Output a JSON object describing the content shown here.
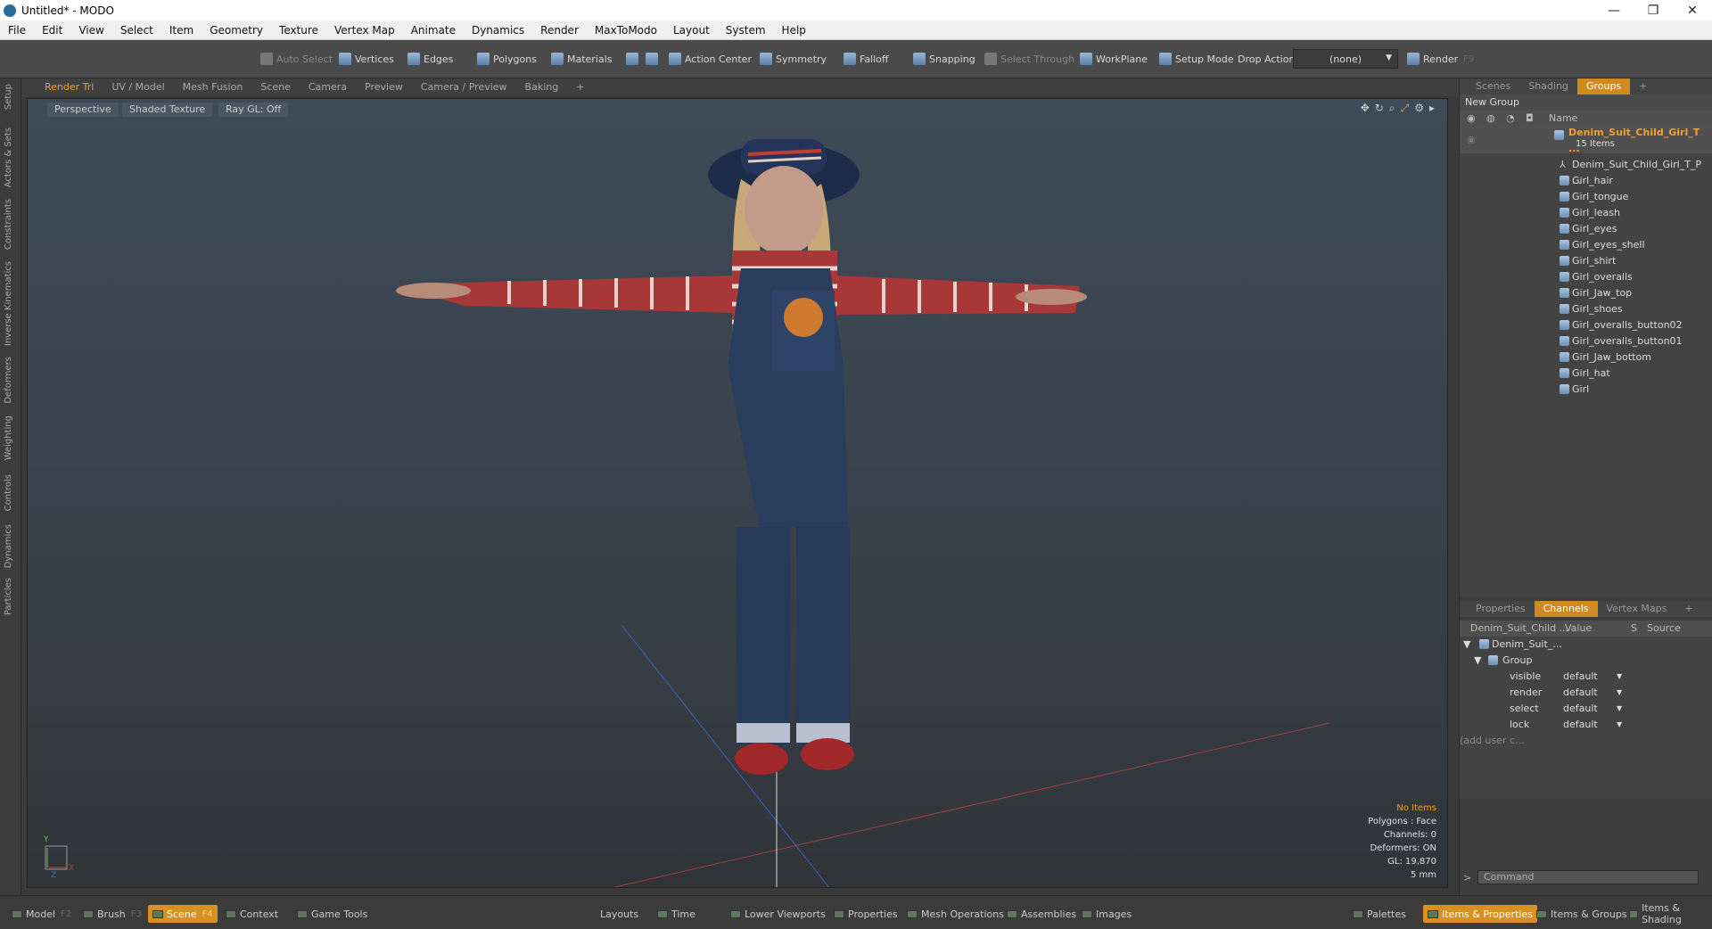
{
  "window": {
    "title": "Untitled* - MODO",
    "minimize": "—",
    "restore": "❐",
    "close": "✕"
  },
  "menu": [
    "File",
    "Edit",
    "View",
    "Select",
    "Item",
    "Geometry",
    "Texture",
    "Vertex Map",
    "Animate",
    "Dynamics",
    "Render",
    "MaxToModo",
    "Layout",
    "System",
    "Help"
  ],
  "toolbar": {
    "auto_select": "Auto Select",
    "vertices": "Vertices",
    "edges": "Edges",
    "polygons": "Polygons",
    "materials": "Materials",
    "action_center": "Action Center",
    "symmetry": "Symmetry",
    "falloff": "Falloff",
    "snapping": "Snapping",
    "select_through": "Select Through",
    "workplane": "WorkPlane",
    "setup_mode": "Setup Mode",
    "drop_action": "Drop Action",
    "drop_value": "(none)",
    "render": "Render",
    "render_key": "F9"
  },
  "left_tabs": [
    "Setup",
    "Actors & Sets",
    "Constraints",
    "Inverse Kinematics",
    "Deformers",
    "Weighting",
    "Controls",
    "Dynamics",
    "Particles"
  ],
  "viewport_tabs": [
    "Render Tri",
    "UV / Model",
    "Mesh Fusion",
    "Scene",
    "Camera",
    "Preview",
    "Camera / Preview",
    "Baking",
    "+"
  ],
  "viewport": {
    "perspective": "Perspective",
    "shading": "Shaded Texture",
    "raygl": "Ray GL: Off",
    "hud": {
      "no_items": "No Items",
      "polygons": "Polygons : Face",
      "channels": "Channels: 0",
      "deformers": "Deformers: ON",
      "gl": "GL: 19,870",
      "scale": "5 mm"
    },
    "axis_y": "Y",
    "axis_x": "X",
    "axis_z": "Z"
  },
  "right_top_tabs": [
    "Scenes",
    "Shading",
    "Groups",
    "+"
  ],
  "groups": {
    "new_group": "New Group",
    "name_header": "Name",
    "root": "Denim_Suit_Child_Girl_T ...",
    "count": "15 Items",
    "items": [
      "Denim_Suit_Child_Girl_T_P ...",
      "Girl_hair",
      "Girl_tongue",
      "Girl_leash",
      "Girl_eyes",
      "Girl_eyes_shell",
      "Girl_shirt",
      "Girl_overalls",
      "Girl_Jaw_top",
      "Girl_shoes",
      "Girl_overalls_button02",
      "Girl_overalls_button01",
      "Girl_Jaw_bottom",
      "Girl_hat",
      "Girl"
    ]
  },
  "right_bottom_tabs": [
    "Properties",
    "Channels",
    "Vertex Maps",
    "+"
  ],
  "channels": {
    "col_name": "Denim_Suit_Child ...",
    "col_value": "Value",
    "col_s": "S",
    "col_source": "Source",
    "item": "Denim_Suit_...",
    "group": "Group",
    "rows": [
      {
        "name": "visible",
        "value": "default"
      },
      {
        "name": "render",
        "value": "default"
      },
      {
        "name": "select",
        "value": "default"
      },
      {
        "name": "lock",
        "value": "default"
      }
    ],
    "add_user": "(add user c..."
  },
  "command_placeholder": "Command",
  "statusbar": {
    "left": [
      {
        "label": "Model",
        "key": "F2"
      },
      {
        "label": "Brush",
        "key": "F3"
      },
      {
        "label": "Scene",
        "key": "F4"
      },
      {
        "label": "Context",
        "key": ""
      },
      {
        "label": "Game Tools",
        "key": ""
      }
    ],
    "middle": [
      "Layouts",
      "Time",
      "Lower Viewports",
      "Properties",
      "Mesh Operations",
      "Assemblies",
      "Images"
    ],
    "right": [
      "Palettes",
      "Items & Properties",
      "Items & Groups",
      "Items & Shading"
    ]
  },
  "colors": {
    "accent": "#d08a20",
    "hud_warn": "#f0a020"
  }
}
